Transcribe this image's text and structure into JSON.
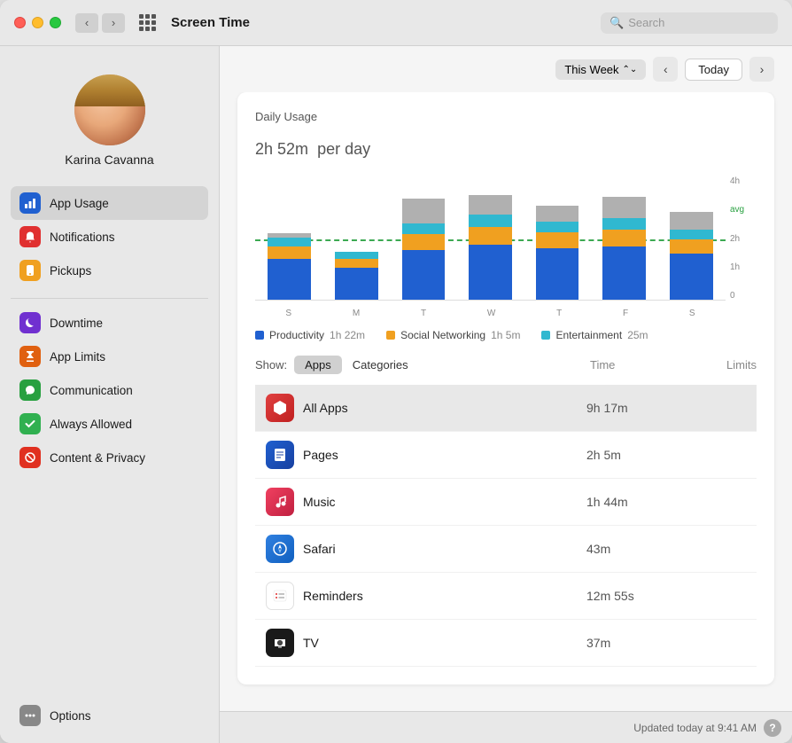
{
  "window": {
    "title": "Screen Time"
  },
  "titlebar": {
    "back_label": "‹",
    "forward_label": "›",
    "title": "Screen Time",
    "search_placeholder": "Search"
  },
  "sidebar": {
    "user_name": "Karina Cavanna",
    "items": [
      {
        "id": "app-usage",
        "label": "App Usage",
        "icon": "chart-icon",
        "icon_char": "📊",
        "active": true
      },
      {
        "id": "notifications",
        "label": "Notifications",
        "icon": "bell-icon",
        "icon_char": "🔔"
      },
      {
        "id": "pickups",
        "label": "Pickups",
        "icon": "pickup-icon",
        "icon_char": "📱"
      }
    ],
    "items2": [
      {
        "id": "downtime",
        "label": "Downtime",
        "icon": "moon-icon",
        "icon_char": "🌙"
      },
      {
        "id": "app-limits",
        "label": "App Limits",
        "icon": "hourglass-icon",
        "icon_char": "⏳"
      },
      {
        "id": "communication",
        "label": "Communication",
        "icon": "speech-icon",
        "icon_char": "💬"
      },
      {
        "id": "always-allowed",
        "label": "Always Allowed",
        "icon": "check-icon",
        "icon_char": "✓"
      },
      {
        "id": "content-privacy",
        "label": "Content & Privacy",
        "icon": "block-icon",
        "icon_char": "⛔"
      }
    ],
    "options_label": "Options"
  },
  "main": {
    "week_selector": "This Week",
    "today_btn": "Today",
    "chart": {
      "daily_usage_label": "Daily Usage",
      "daily_usage_value": "2h 52m",
      "daily_usage_suffix": "per day",
      "bars": [
        {
          "day": "S",
          "blue": 35,
          "orange": 10,
          "cyan": 8,
          "gray": 5
        },
        {
          "day": "M",
          "blue": 28,
          "orange": 8,
          "cyan": 6,
          "gray": 4
        },
        {
          "day": "T",
          "blue": 48,
          "orange": 14,
          "cyan": 10,
          "gray": 22
        },
        {
          "day": "W",
          "blue": 55,
          "orange": 16,
          "cyan": 12,
          "gray": 18
        },
        {
          "day": "T",
          "blue": 50,
          "orange": 14,
          "cyan": 10,
          "gray": 15
        },
        {
          "day": "F",
          "blue": 52,
          "orange": 15,
          "cyan": 11,
          "gray": 20
        },
        {
          "day": "S",
          "blue": 45,
          "orange": 13,
          "cyan": 9,
          "gray": 16
        }
      ],
      "y_labels": [
        "4h",
        "2h",
        "1h",
        "0"
      ],
      "avg_label": "avg",
      "legend": [
        {
          "color": "#2060d0",
          "label": "Productivity",
          "time": "1h 22m"
        },
        {
          "color": "#f0a020",
          "label": "Social Networking",
          "time": "1h 5m"
        },
        {
          "color": "#30b8d0",
          "label": "Entertainment",
          "time": "25m"
        }
      ]
    },
    "show_label": "Show:",
    "tabs": [
      {
        "id": "apps",
        "label": "Apps",
        "active": true
      },
      {
        "id": "categories",
        "label": "Categories",
        "active": false
      }
    ],
    "table": {
      "col_time": "Time",
      "col_limits": "Limits",
      "rows": [
        {
          "name": "All Apps",
          "time": "9h 17m",
          "highlighted": true
        },
        {
          "name": "Pages",
          "time": "2h 5m"
        },
        {
          "name": "Music",
          "time": "1h 44m"
        },
        {
          "name": "Safari",
          "time": "43m"
        },
        {
          "name": "Reminders",
          "time": "12m 55s"
        },
        {
          "name": "TV",
          "time": "37m"
        }
      ]
    }
  },
  "statusbar": {
    "updated_text": "Updated today at 9:41 AM",
    "help": "?"
  }
}
